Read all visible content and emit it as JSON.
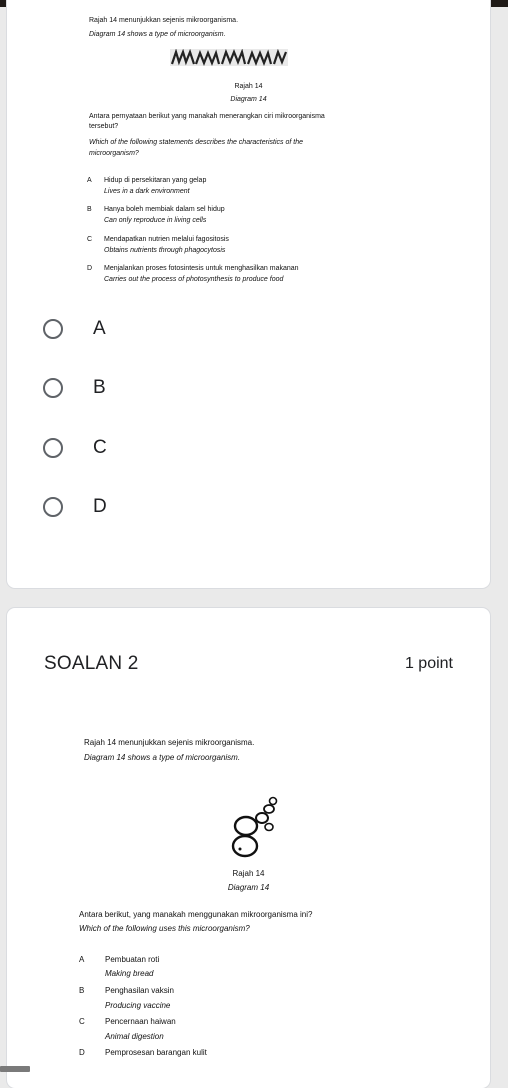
{
  "question1": {
    "image_text": {
      "intro_ms": "Rajah 14 menunjukkan sejenis mikroorganisma.",
      "intro_en": "Diagram 14 shows a type of microorganism.",
      "caption_ms": "Rajah 14",
      "caption_en": "Diagram 14",
      "stem_ms_1": "Antara pernyataan berikut yang manakah menerangkan ciri mikroorganisma",
      "stem_ms_2": "tersebut?",
      "stem_en_1": "Which of the following statements describes the characteristics of the",
      "stem_en_2": "microorganism?",
      "choices": [
        {
          "letter": "A",
          "ms": "Hidup di persekitaran yang gelap",
          "en": "Lives in a dark environment"
        },
        {
          "letter": "B",
          "ms": "Hanya boleh membiak dalam sel hidup",
          "en": "Can only reproduce in living cells"
        },
        {
          "letter": "C",
          "ms": "Mendapatkan nutrien melalui fagositosis",
          "en": "Obtains nutrients through phagocytosis"
        },
        {
          "letter": "D",
          "ms": "Menjalankan proses fotosintesis untuk menghasilkan makanan",
          "en": "Carries out the process of photosynthesis to produce food"
        }
      ]
    },
    "options": [
      "A",
      "B",
      "C",
      "D"
    ]
  },
  "question2": {
    "title": "SOALAN 2",
    "points": "1 point",
    "image_text": {
      "intro_ms": "Rajah 14 menunjukkan sejenis mikroorganisma.",
      "intro_en": "Diagram 14 shows a type of microorganism.",
      "caption_ms": "Rajah 14",
      "caption_en": "Diagram 14",
      "stem_ms": "Antara berikut, yang manakah menggunakan mikroorganisma ini?",
      "stem_en": "Which of the following uses this microorganism?",
      "choices": [
        {
          "letter": "A",
          "ms": "Pembuatan roti",
          "en": "Making bread"
        },
        {
          "letter": "B",
          "ms": "Penghasilan vaksin",
          "en": "Producing vaccine"
        },
        {
          "letter": "C",
          "ms": "Pencernaan haiwan",
          "en": "Animal digestion"
        },
        {
          "letter": "D",
          "ms": "Pemprosesan barangan kulit",
          "en": ""
        }
      ]
    }
  }
}
